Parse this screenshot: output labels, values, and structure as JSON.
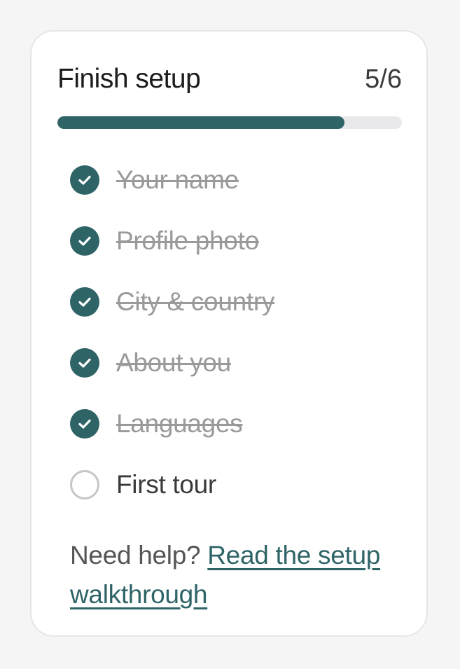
{
  "setup": {
    "title": "Finish setup",
    "progress_text": "5/6",
    "progress_fraction": 0.8333,
    "accent_color": "#2f6467",
    "tasks": [
      {
        "label": "Your name",
        "completed": true,
        "icon": "check-circle-icon"
      },
      {
        "label": "Profile photo",
        "completed": true,
        "icon": "check-circle-icon"
      },
      {
        "label": "City & country",
        "completed": true,
        "icon": "check-circle-icon"
      },
      {
        "label": "About you",
        "completed": true,
        "icon": "check-circle-icon"
      },
      {
        "label": "Languages",
        "completed": true,
        "icon": "check-circle-icon"
      },
      {
        "label": "First tour",
        "completed": false,
        "icon": "empty-circle-icon"
      }
    ],
    "help": {
      "prefix": "Need help? ",
      "link_text": "Read the setup walkthrough"
    }
  }
}
